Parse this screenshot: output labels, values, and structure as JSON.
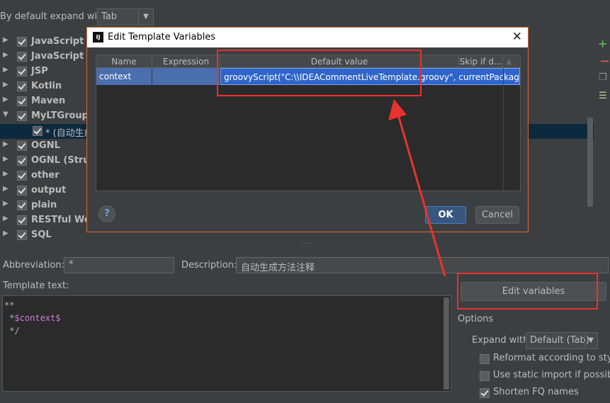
{
  "top": {
    "expand_label": "By default expand with",
    "expand_value": "Tab"
  },
  "tree": {
    "groups": [
      "JavaScript",
      "JavaScript Te",
      "JSP",
      "Kotlin",
      "Maven",
      "MyLTGroup",
      "OGNL",
      "OGNL (Struts",
      "other",
      "output",
      "plain",
      "RESTful Web",
      "SQL"
    ],
    "child": "* (自动生成"
  },
  "form": {
    "abbr_label": "Abbreviation:",
    "abbr_value": "*",
    "desc_label": "Description:",
    "desc_value": "自动生成方法注释",
    "template_label": "Template text:",
    "template_lines": [
      "**",
      " *",
      "$context$",
      " */"
    ],
    "edit_vars": "Edit variables",
    "options_label": "Options",
    "expand_with_label": "Expand with",
    "expand_with_value": "Default (Tab)",
    "options": [
      {
        "label": "Reformat according to style",
        "checked": false
      },
      {
        "label": "Use static import if possible",
        "checked": false
      },
      {
        "label": "Shorten FQ names",
        "checked": true
      }
    ]
  },
  "dialog": {
    "title": "Edit Template Variables",
    "logo": "IJ",
    "columns": [
      "Name",
      "Expression",
      "Default value",
      "Skip if d..."
    ],
    "row": {
      "name": "context",
      "expression": "",
      "default_value": "groovyScript(\"C:\\\\IDEACommentLiveTemplate.groovy\", currentPackage(), className(), methodName())"
    },
    "help": "?",
    "ok": "OK",
    "cancel": "Cancel"
  },
  "colors": {
    "annotation_red": "#e8322e",
    "selection_blue": "#4b6eaf",
    "ok_blue": "#365880"
  }
}
